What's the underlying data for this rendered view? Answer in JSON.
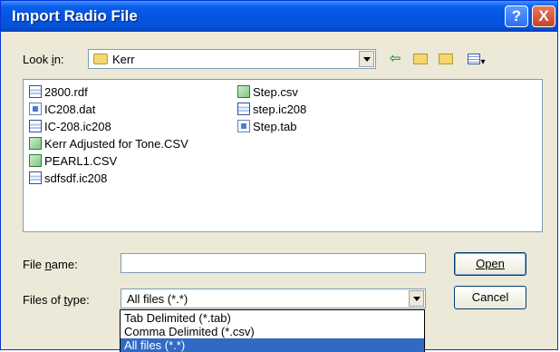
{
  "window": {
    "title": "Import Radio File",
    "help_label": "?",
    "close_label": "X"
  },
  "look_in": {
    "label": "Look in:",
    "folder": "Kerr"
  },
  "toolbar": {
    "back_icon": "back-arrow-icon",
    "up_icon": "up-folder-icon",
    "new_folder_icon": "new-folder-icon",
    "views_icon": "views-menu-icon"
  },
  "files": [
    {
      "name": "2800.rdf",
      "icon": "doc"
    },
    {
      "name": "IC208.dat",
      "icon": "txt"
    },
    {
      "name": "IC-208.ic208",
      "icon": "doc"
    },
    {
      "name": "Kerr Adjusted for Tone.CSV",
      "icon": "csv"
    },
    {
      "name": "PEARL1.CSV",
      "icon": "csv"
    },
    {
      "name": "sdfsdf.ic208",
      "icon": "doc"
    },
    {
      "name": "Step.csv",
      "icon": "csv"
    },
    {
      "name": "step.ic208",
      "icon": "doc"
    },
    {
      "name": "Step.tab",
      "icon": "txt"
    }
  ],
  "file_name": {
    "label": "File name:",
    "value": ""
  },
  "files_of_type": {
    "label": "Files of type:",
    "selected": "All files (*.*)",
    "options": [
      "Tab Delimited  (*.tab)",
      "Comma Delimited  (*.csv)",
      "All files (*.*)"
    ]
  },
  "buttons": {
    "open": "Open",
    "cancel": "Cancel"
  },
  "colors": {
    "titlebar": "#0554e3",
    "selection": "#316ac5",
    "dialog_bg": "#ece9d8"
  }
}
